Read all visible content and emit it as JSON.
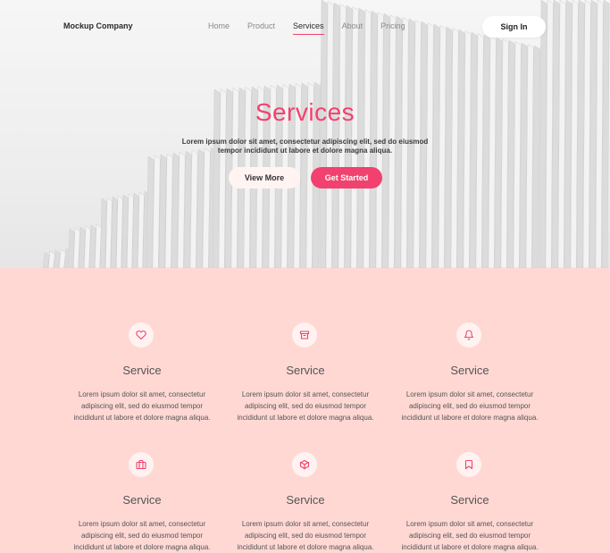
{
  "nav": {
    "brand": "Mockup Company",
    "links": [
      "Home",
      "Product",
      "Services",
      "About",
      "Pricing"
    ],
    "active_index": 2,
    "signin_label": "Sign In"
  },
  "hero": {
    "title": "Services",
    "subtitle": "Lorem ipsum dolor sit amet, consectetur adipiscing elit, sed do eiusmod tempor incididunt ut labore et dolore magna aliqua.",
    "view_more_label": "View More",
    "get_started_label": "Get Started"
  },
  "services": [
    {
      "icon": "heart-icon",
      "title": "Service",
      "desc": "Lorem ipsum dolor sit amet, consectetur adipiscing elit, sed do eiusmod tempor incididunt ut labore et dolore magna aliqua."
    },
    {
      "icon": "archive-icon",
      "title": "Service",
      "desc": "Lorem ipsum dolor sit amet, consectetur adipiscing elit, sed do eiusmod tempor incididunt ut labore et dolore magna aliqua."
    },
    {
      "icon": "bell-icon",
      "title": "Service",
      "desc": "Lorem ipsum dolor sit amet, consectetur adipiscing elit, sed do eiusmod tempor incididunt ut labore et dolore magna aliqua."
    },
    {
      "icon": "briefcase-icon",
      "title": "Service",
      "desc": "Lorem ipsum dolor sit amet, consectetur adipiscing elit, sed do eiusmod tempor incididunt ut labore et dolore magna aliqua."
    },
    {
      "icon": "box-icon",
      "title": "Service",
      "desc": "Lorem ipsum dolor sit amet, consectetur adipiscing elit, sed do eiusmod tempor incididunt ut labore et dolore magna aliqua."
    },
    {
      "icon": "bookmark-icon",
      "title": "Service",
      "desc": "Lorem ipsum dolor sit amet, consectetur adipiscing elit, sed do eiusmod tempor incididunt ut labore et dolore magna aliqua."
    }
  ],
  "colors": {
    "accent": "#f2416e",
    "section_bg": "#ffd8d4",
    "icon_bg": "#fff2f0"
  }
}
